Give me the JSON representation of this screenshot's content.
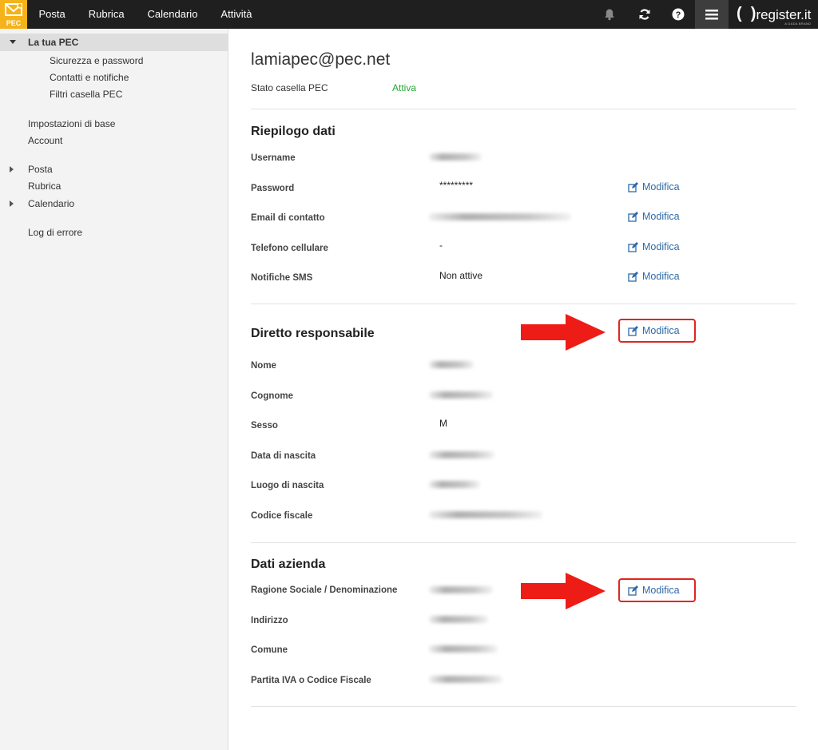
{
  "topbar": {
    "logo_text": "PEC",
    "nav": [
      "Posta",
      "Rubrica",
      "Calendario",
      "Attività"
    ],
    "icons": [
      "bell-icon",
      "refresh-icon",
      "help-icon",
      "menu-icon"
    ],
    "brand": "register.it",
    "brand_sub": "A DADA BRAND"
  },
  "sidebar": {
    "head": "La tua PEC",
    "sub_items": [
      "Sicurezza e password",
      "Contatti e notifiche",
      "Filtri casella PEC"
    ],
    "items": [
      "Impostazioni di base",
      "Account",
      "Posta",
      "Rubrica",
      "Calendario",
      "Log di errore"
    ]
  },
  "main": {
    "email": "lamiapec@pec.net",
    "status_label": "Stato casella PEC",
    "status_value": "Attiva",
    "edit_label": "Modifica",
    "summary": {
      "title": "Riepilogo dati",
      "fields": {
        "username": "Username",
        "password": "Password",
        "password_value": "*********",
        "email": "Email di contatto",
        "phone": "Telefono cellulare",
        "phone_value": "-",
        "sms": "Notifiche SMS",
        "sms_value": "Non attive"
      }
    },
    "responsible": {
      "title": "Diretto responsabile",
      "fields": {
        "name": "Nome",
        "surname": "Cognome",
        "sex": "Sesso",
        "sex_value": "M",
        "birth_date": "Data di nascita",
        "birth_place": "Luogo di nascita",
        "tax_code": "Codice fiscale"
      }
    },
    "company": {
      "title": "Dati azienda",
      "fields": {
        "name": "Ragione Sociale / Denominazione",
        "address": "Indirizzo",
        "city": "Comune",
        "vat": "Partita IVA o Codice Fiscale"
      }
    }
  },
  "colors": {
    "accent": "#f5b21b",
    "link": "#2f6aa8",
    "status_ok": "#2aa637",
    "highlight": "#e0261f"
  }
}
